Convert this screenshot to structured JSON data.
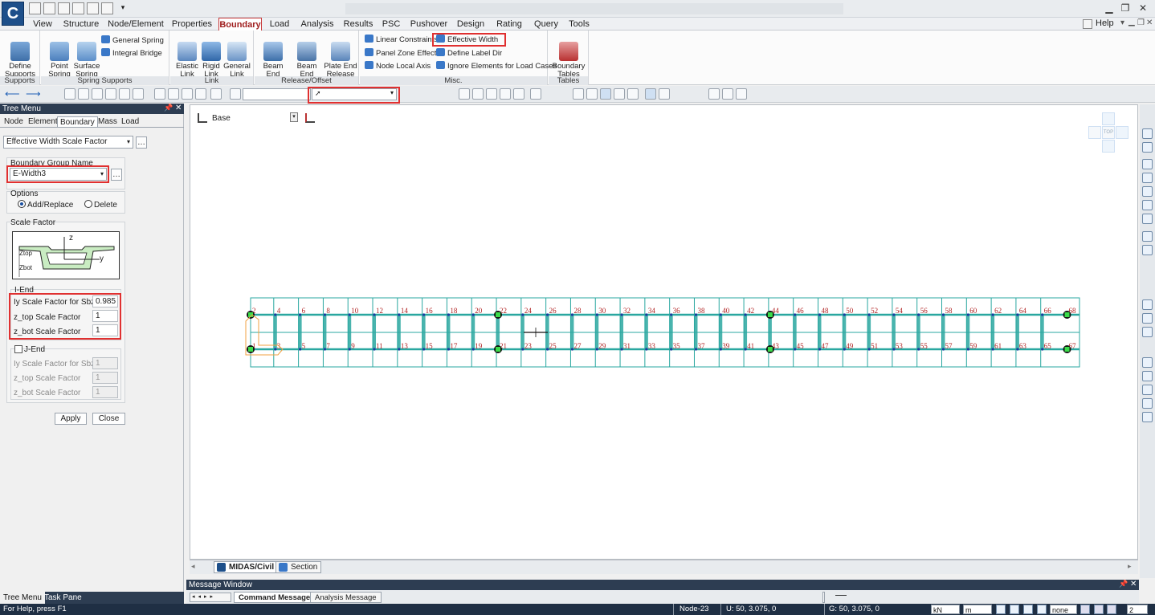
{
  "app": {
    "logo_letter": "C",
    "help_label": "Help"
  },
  "menu_tabs": [
    "View",
    "Structure",
    "Node/Element",
    "Properties",
    "Boundary",
    "Load",
    "Analysis",
    "Results",
    "PSC",
    "Pushover",
    "Design",
    "Rating",
    "Query",
    "Tools"
  ],
  "active_menu_tab": "Boundary",
  "ribbon": {
    "supports": {
      "title": "Supports",
      "define_supports": "Define\nSupports"
    },
    "spring": {
      "title": "Spring Supports",
      "point_spring": "Point\nSpring",
      "surface_spring": "Surface\nSpring",
      "general_spring": "General Spring",
      "integral_bridge": "Integral Bridge"
    },
    "link": {
      "title": "Link",
      "elastic_link": "Elastic\nLink",
      "rigid_link": "Rigid\nLink",
      "general_link": "General\nLink"
    },
    "release": {
      "title": "Release/Offset",
      "beam_end_release": "Beam End\nRelease",
      "beam_end_offsets": "Beam End\nOffsets",
      "plate_end_release": "Plate End\nRelease"
    },
    "misc": {
      "title": "Misc.",
      "linear_constraints": "Linear Constraints",
      "effective_width": "Effective Width",
      "panel_zone_effects": "Panel Zone Effects",
      "define_label_dir": "Define Label Dir",
      "node_local_axis": "Node Local Axis",
      "ignore_elements": "Ignore Elements for Load Cases"
    },
    "tables": {
      "title": "Tables",
      "boundary_tables": "Boundary\nTables"
    }
  },
  "tree": {
    "header": "Tree Menu",
    "tabs": [
      "Node",
      "Element",
      "Boundary",
      "Mass",
      "Load"
    ],
    "active_tab": "Boundary",
    "function_select": "Effective Width Scale Factor",
    "group_label": "Boundary Group Name",
    "group_value": "E-Width3",
    "options_label": "Options",
    "opt_add": "Add/Replace",
    "opt_delete": "Delete",
    "scale_label": "Scale Factor",
    "diagram": {
      "z": "z",
      "y": "y",
      "ztop": "Ztop",
      "zbot": "Zbot"
    },
    "iend_label": "I-End",
    "iend_fields": [
      {
        "label": "Iy Scale Factor for Sbz",
        "value": "0.985"
      },
      {
        "label": "z_top Scale Factor",
        "value": "1"
      },
      {
        "label": "z_bot Scale Factor",
        "value": "1"
      }
    ],
    "jend_label": "J-End",
    "jend_fields": [
      {
        "label": "Iy Scale Factor for Sbz",
        "value": "1"
      },
      {
        "label": "z_top Scale Factor",
        "value": "1"
      },
      {
        "label": "z_bot Scale Factor",
        "value": "1"
      }
    ],
    "apply": "Apply",
    "close": "Close",
    "bottom_tabs": [
      "Tree Menu",
      "Task Pane"
    ]
  },
  "canvas": {
    "base_label": "Base",
    "view_cube_label": "TOP",
    "top_row_labels": [
      "2",
      "4",
      "6",
      "8",
      "10",
      "12",
      "14",
      "16",
      "18",
      "20",
      "22",
      "24",
      "26",
      "28",
      "30",
      "32",
      "34",
      "36",
      "38",
      "40",
      "42",
      "44",
      "46",
      "48",
      "50",
      "52",
      "54",
      "56",
      "58",
      "60",
      "62",
      "64",
      "66",
      "68"
    ],
    "bottom_row_labels": [
      "1",
      "3",
      "5",
      "7",
      "9",
      "11",
      "13",
      "15",
      "17",
      "19",
      "21",
      "23",
      "25",
      "27",
      "29",
      "31",
      "33",
      "35",
      "37",
      "39",
      "41",
      "43",
      "45",
      "47",
      "49",
      "51",
      "53",
      "55",
      "57",
      "59",
      "61",
      "63",
      "65",
      "67"
    ],
    "tabs": [
      "MIDAS/Civil",
      "Section"
    ]
  },
  "message": {
    "header": "Message Window",
    "tabs": [
      "Command Message",
      "Analysis Message"
    ]
  },
  "status": {
    "help": "For Help, press F1",
    "node": "Node-23",
    "u_coord": "U: 50, 3.075, 0",
    "g_coord": "G: 50, 3.075, 0",
    "force_unit": "kN",
    "length_unit": "m",
    "none_label": "none",
    "page": "2"
  },
  "colors": {
    "accent_red": "#e03030",
    "mesh": "#2aa7a0",
    "node_label": "#b02020",
    "nav_dark": "#2d3d52"
  }
}
